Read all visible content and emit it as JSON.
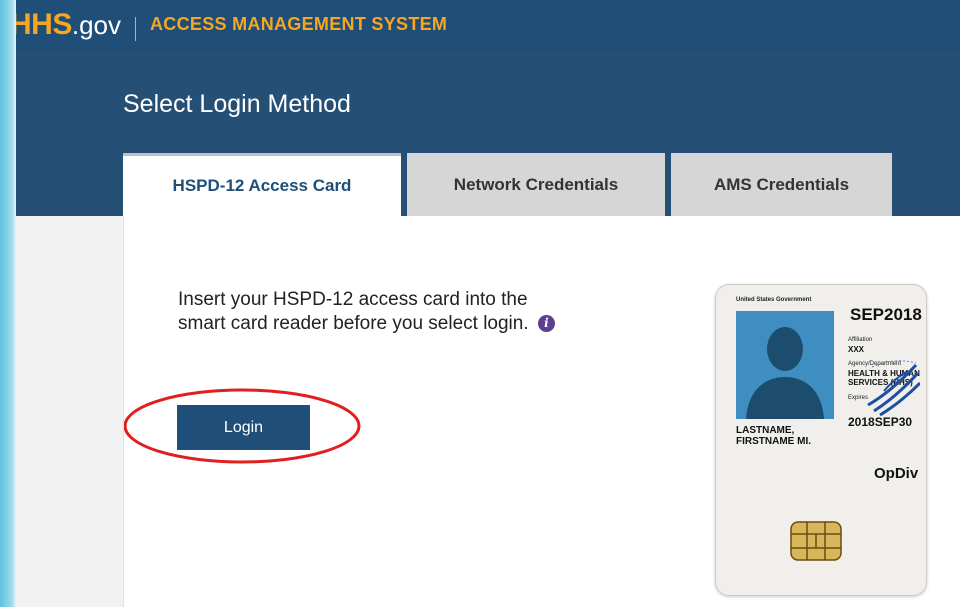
{
  "header": {
    "brand_hhs": "HHS",
    "brand_gov": ".gov",
    "system_title": "ACCESS MANAGEMENT SYSTEM"
  },
  "page": {
    "title": "Select Login Method"
  },
  "tabs": [
    {
      "label": "HSPD-12 Access Card",
      "active": true
    },
    {
      "label": "Network Credentials",
      "active": false
    },
    {
      "label": "AMS Credentials",
      "active": false
    }
  ],
  "panel": {
    "instructions": "Insert your HSPD-12 access card into the smart card reader before you select login.",
    "info_icon": "i",
    "login_label": "Login"
  },
  "card": {
    "gov_label": "United States Government",
    "expiry": "SEP2018",
    "affiliation_label": "Affiliation",
    "affiliation": "XXX",
    "agency_label": "Agency/Department",
    "agency": "HEALTH & HUMAN SERVICES (HHS)",
    "expires_label": "Expires",
    "expires": "2018SEP30",
    "name_line1": "LASTNAME,",
    "name_line2": "FIRSTNAME MI.",
    "opdiv": "OpDiv"
  },
  "colors": {
    "brand_orange": "#f5a623",
    "navy": "#1f4e79",
    "annotation_red": "#e02020"
  }
}
